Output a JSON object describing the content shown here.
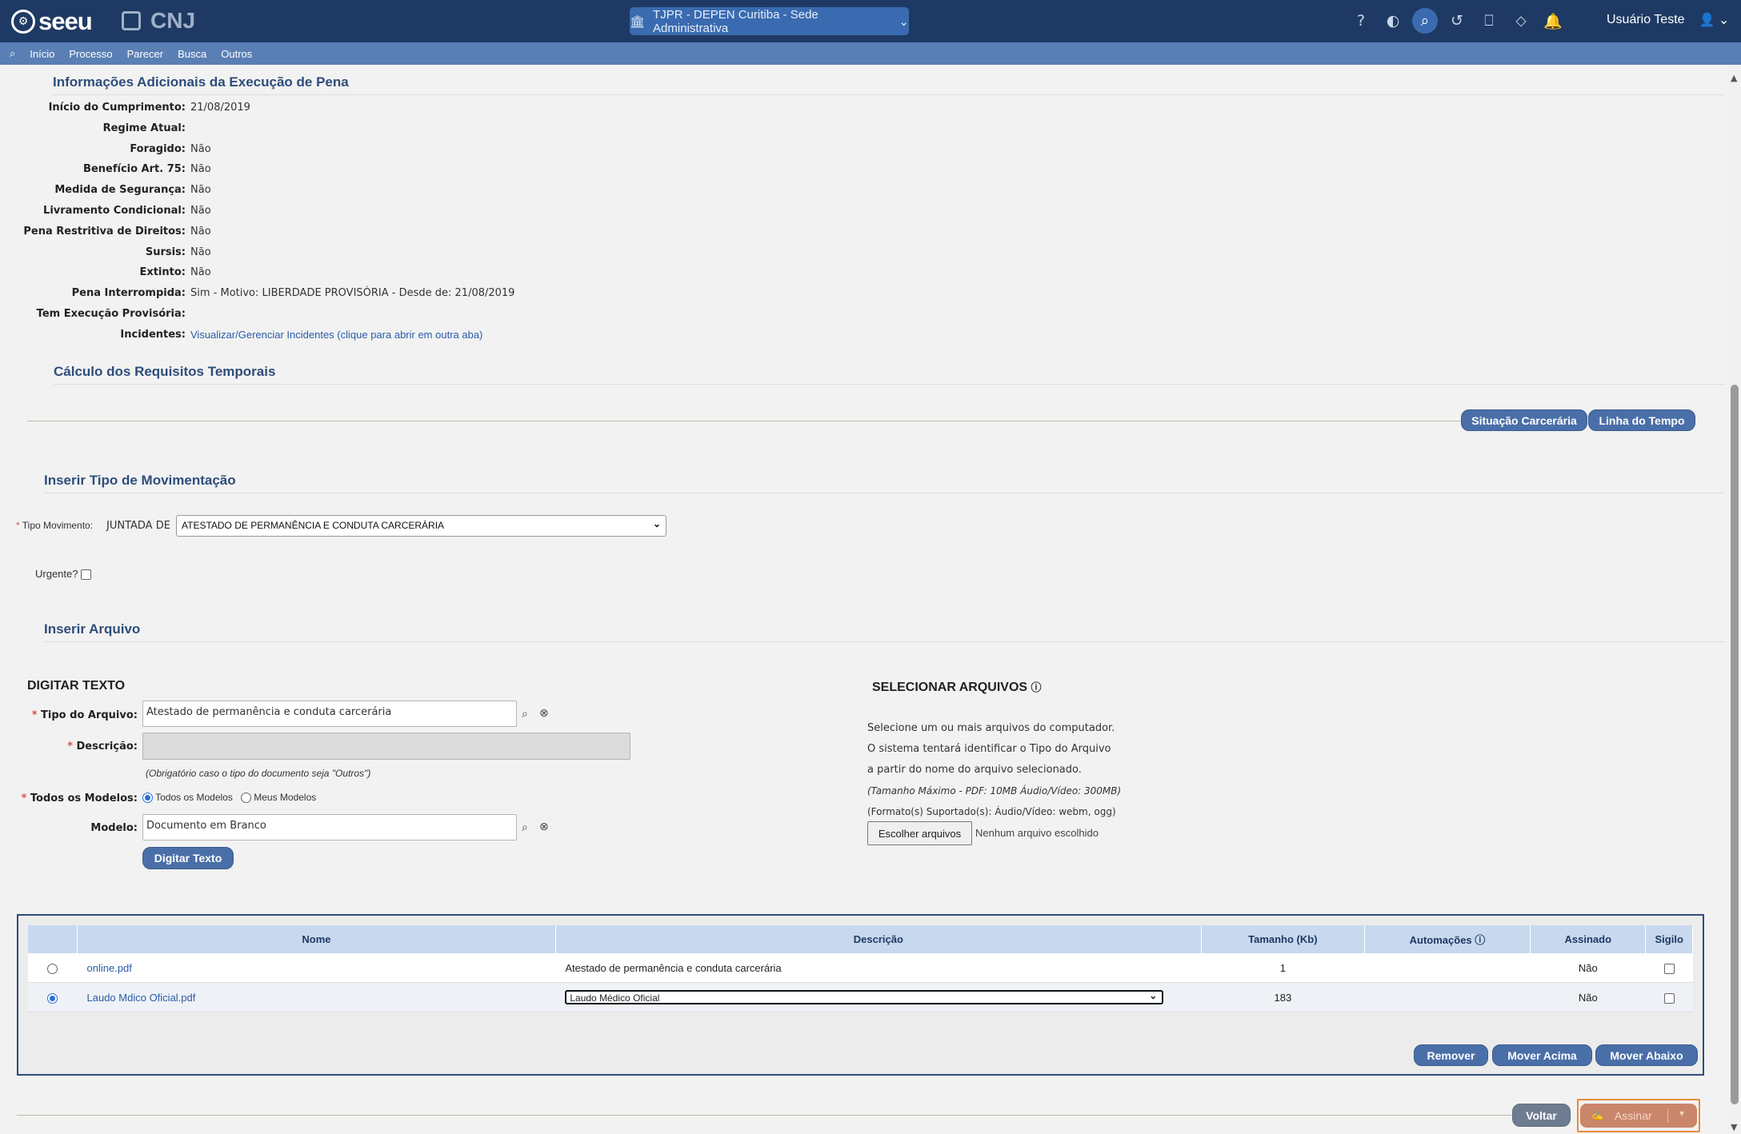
{
  "topbar": {
    "logo": "seeu",
    "cnj": "CNJ",
    "unit_selector": "TJPR - DEPEN Curitiba - Sede Administrativa",
    "user_name": "Usuário Teste"
  },
  "menu": [
    "Início",
    "Processo",
    "Parecer",
    "Busca",
    "Outros"
  ],
  "info_section": {
    "title": "Informações Adicionais da Execução de Pena",
    "rows": [
      {
        "label": "Início do Cumprimento:",
        "value": "21/08/2019"
      },
      {
        "label": "Regime Atual:",
        "value": ""
      },
      {
        "label": "Foragido:",
        "value": "Não"
      },
      {
        "label": "Benefício Art. 75:",
        "value": "Não"
      },
      {
        "label": "Medida de Segurança:",
        "value": "Não"
      },
      {
        "label": "Livramento Condicional:",
        "value": "Não"
      },
      {
        "label": "Pena Restritiva de Direitos:",
        "value": "Não"
      },
      {
        "label": "Sursis:",
        "value": "Não"
      },
      {
        "label": "Extinto:",
        "value": "Não"
      },
      {
        "label": "Pena Interrompida:",
        "value": "Sim - Motivo: LIBERDADE PROVISÓRIA - Desde de: 21/08/2019"
      },
      {
        "label": "Tem Execução Provisória:",
        "value": ""
      },
      {
        "label": "Incidentes:",
        "value": "Visualizar/Gerenciar Incidentes (clique para abrir em outra aba)"
      }
    ]
  },
  "calc_section": {
    "title": "Cálculo dos Requisitos Temporais",
    "btn_situacao": "Situação Carcerária",
    "btn_linha": "Linha do Tempo"
  },
  "mov_section": {
    "title": "Inserir Tipo de Movimentação",
    "tipo_label": "Tipo Movimento:",
    "prefix": "JUNTADA DE",
    "tipo_value": "ATESTADO DE PERMANÊNCIA E CONDUTA CARCERÁRIA",
    "urgente_label": "Urgente?"
  },
  "arquivo_section": {
    "title": "Inserir Arquivo",
    "digitar": {
      "title": "DIGITAR TEXTO",
      "tipo_label": "Tipo do Arquivo:",
      "tipo_value": "Atestado de permanência e conduta carcerária",
      "descricao_label": "Descrição:",
      "descricao_hint": "(Obrigatório caso o tipo do documento seja \"Outros\")",
      "modelos_label": "Todos os Modelos:",
      "opt_todos": "Todos os Modelos",
      "opt_meus": "Meus Modelos",
      "modelo_label": "Modelo:",
      "modelo_value": "Documento em Branco",
      "btn_digitar": "Digitar Texto"
    },
    "selecionar": {
      "title": "SELECIONAR ARQUIVOS",
      "line1": "Selecione um ou mais arquivos do computador.",
      "line2": "O sistema tentará identificar o Tipo do Arquivo",
      "line3": "a partir do nome do arquivo selecionado.",
      "line4": "(Tamanho Máximo - PDF: 10MB  Áudio/Vídeo: 300MB)",
      "line5": "(Formato(s) Suportado(s): Áudio/Vídeo: webm, ogg)",
      "btn_escolher": "Escolher arquivos",
      "nenhum": "Nenhum arquivo escolhido"
    }
  },
  "table": {
    "headers": [
      "Nome",
      "Descrição",
      "Tamanho (Kb)",
      "Automações",
      "Assinado",
      "Sigilo"
    ],
    "rows": [
      {
        "nome": "online.pdf",
        "descricao": "Atestado de permanência e conduta carcerária",
        "tamanho": "1",
        "assinado": "Não"
      },
      {
        "nome": "Laudo Mdico Oficial.pdf",
        "descricao": "Laudo Médico Oficial",
        "tamanho": "183",
        "assinado": "Não"
      }
    ],
    "btn_remover": "Remover",
    "btn_acima": "Mover Acima",
    "btn_abaixo": "Mover Abaixo"
  },
  "footer": {
    "btn_voltar": "Voltar",
    "btn_assinar": "Assinar"
  },
  "colors": {
    "topbar": "#1e3a64",
    "menubar": "#5a7fb5",
    "button": "#4a6fa8",
    "heading": "#2f4d7a",
    "assinar": "#c9866a"
  }
}
